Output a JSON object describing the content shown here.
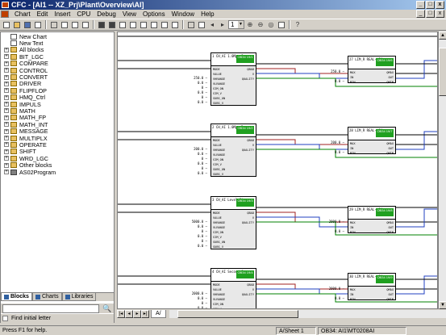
{
  "window": {
    "title": "CFC - [AI1 -- XZ_Prj\\Plant\\Overview\\AI]",
    "min": "_",
    "max": "□",
    "close": "x"
  },
  "menu": [
    "Chart",
    "Edit",
    "Insert",
    "CPU",
    "Debug",
    "View",
    "Options",
    "Window",
    "Help"
  ],
  "toolbar": {
    "sheet_number": "1"
  },
  "tree": [
    {
      "label": "New Chart",
      "icon": "doc-icon",
      "expand": false
    },
    {
      "label": "New Text",
      "icon": "doc-icon",
      "expand": false
    },
    {
      "label": "All blocks",
      "icon": "folder-icon",
      "expand": true
    },
    {
      "label": "BIT_LGC",
      "icon": "folder-icon",
      "expand": true
    },
    {
      "label": "COMPARE",
      "icon": "folder-icon",
      "expand": true
    },
    {
      "label": "CONTROL",
      "icon": "folder-icon",
      "expand": true
    },
    {
      "label": "CONVERT",
      "icon": "folder-icon",
      "expand": true
    },
    {
      "label": "DRIVER",
      "icon": "folder-icon",
      "expand": true
    },
    {
      "label": "FLIPFLOP",
      "icon": "folder-icon",
      "expand": true
    },
    {
      "label": "HMQ_Ctrl",
      "icon": "folder-icon",
      "expand": true
    },
    {
      "label": "IMPULS",
      "icon": "folder-icon",
      "expand": true
    },
    {
      "label": "MATH",
      "icon": "folder-icon",
      "expand": true
    },
    {
      "label": "MATH_FP",
      "icon": "folder-icon",
      "expand": true
    },
    {
      "label": "MATH_INT",
      "icon": "folder-icon",
      "expand": true
    },
    {
      "label": "MESSAGE",
      "icon": "folder-icon",
      "expand": true
    },
    {
      "label": "MULTIPLX",
      "icon": "folder-icon",
      "expand": true
    },
    {
      "label": "OPERATE",
      "icon": "folder-icon",
      "expand": true
    },
    {
      "label": "SHIFT",
      "icon": "folder-icon",
      "expand": true
    },
    {
      "label": "WRD_LGC",
      "icon": "folder-icon",
      "expand": true
    },
    {
      "label": "Other blocks",
      "icon": "folder-icon",
      "expand": true
    },
    {
      "label": "AS02Program",
      "icon": "lib-icon",
      "expand": true
    }
  ],
  "tabs": {
    "blocks": "Blocks",
    "charts": "Charts",
    "libraries": "Libraries"
  },
  "find": {
    "checkbox_label": "Find initial letter",
    "binoculars": "🔍"
  },
  "sheet_tab": "A/",
  "status": {
    "help": "Press F1 for help.",
    "sheet": "A/Sheet 1",
    "location": "OB34: AI1\\MT0208AI"
  },
  "blocks": [
    {
      "name": "1\nCH_AI\n1.0Mpa S",
      "ob": "OB34\n19/1",
      "inputs": [
        "MODE",
        "VALUE",
        "VHRANGE",
        "VLRANGE",
        "SIM_ON",
        "SIM_V",
        "SUBS_ON",
        "SUBS_V"
      ],
      "outputs": [
        "QBAD",
        "V",
        "QUALITY"
      ],
      "vals": [
        "",
        "",
        "250.0",
        "0.0",
        "0",
        "0.0",
        "0",
        "0.0"
      ]
    },
    {
      "name": "2\nCH_AI\n1.0Mpa D",
      "ob": "OB34\n19/2",
      "inputs": [
        "MODE",
        "VALUE",
        "VHRANGE",
        "VLRANGE",
        "SIM_ON",
        "SIM_V",
        "SUBS_ON",
        "SUBS_V"
      ],
      "outputs": [
        "QBAD",
        "V",
        "QUALITY"
      ],
      "vals": [
        "",
        "",
        "200.0",
        "0.0",
        "0",
        "0.0",
        "0",
        "0.0"
      ]
    },
    {
      "name": "3\nCH_AI\nLevel Sim",
      "ob": "OB34\n19/3",
      "inputs": [
        "MODE",
        "VALUE",
        "VHRANGE",
        "VLRANGE",
        "SIM_ON",
        "SIM_V",
        "SUBS_ON",
        "SUBS_V"
      ],
      "outputs": [
        "QBAD",
        "V",
        "QUALITY"
      ],
      "vals": [
        "",
        "",
        "5000.0",
        "0.0",
        "0",
        "0.0",
        "0",
        "0.0"
      ]
    },
    {
      "name": "4\nCH_AI\nSecond S",
      "ob": "OB34\n19/4",
      "inputs": [
        "MODE",
        "VALUE",
        "VHRANGE",
        "VLRANGE",
        "SIM_ON",
        "SIM_V",
        "SUBS_ON",
        "SUBS_V"
      ],
      "outputs": [
        "QBAD",
        "V",
        "QUALITY"
      ],
      "vals": [
        "",
        "",
        "2000.0",
        "0.0",
        "0",
        "0.0",
        "0",
        "0.0"
      ]
    }
  ],
  "limits": [
    {
      "name": "27\nLIM_R\nREAL-LIM",
      "ob": "OB34\n19/6",
      "inputs": [
        "MAX",
        "IN",
        "MIN"
      ],
      "outputs": [
        "QMAX",
        "OUT",
        "QMIN"
      ],
      "vals": [
        "250.0",
        "",
        "0.0"
      ]
    },
    {
      "name": "28\nLIM_R\nREAL-LIM",
      "ob": "OB34\n19/7",
      "inputs": [
        "MAX",
        "IN",
        "MIN"
      ],
      "outputs": [
        "QMAX",
        "OUT",
        "QMIN"
      ],
      "vals": [
        "200.0",
        "",
        "0.0"
      ]
    },
    {
      "name": "29\nLIM_R\nREAL-LIM",
      "ob": "OB34\n19/8",
      "inputs": [
        "MAX",
        "IN",
        "MIN"
      ],
      "outputs": [
        "QMAX",
        "OUT",
        "QMIN"
      ],
      "vals": [
        "2000.0",
        "",
        "0.0"
      ]
    },
    {
      "name": "30\nLIM_R\nREAL-LIM",
      "ob": "OB34\n19/9",
      "inputs": [
        "MAX",
        "IN",
        "MIN"
      ],
      "outputs": [
        "QMAX",
        "OUT",
        "QMIN"
      ],
      "vals": [
        "2000.0",
        "",
        "0.0"
      ]
    }
  ],
  "colors": {
    "title_start": "#0a246a",
    "title_end": "#a6caf0",
    "ob_tag": "#20a020",
    "wire_black": "#000000",
    "wire_red": "#a02020",
    "wire_blue": "#2040c0",
    "wire_green": "#008000"
  }
}
